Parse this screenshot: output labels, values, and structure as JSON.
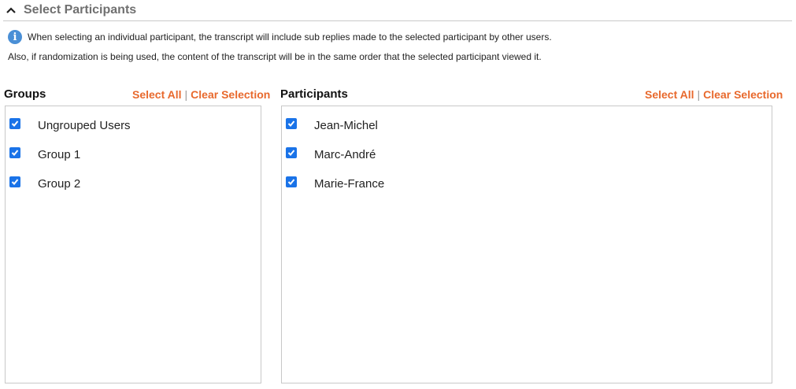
{
  "header": {
    "title": "Select Participants"
  },
  "info": {
    "line1": "When selecting an individual participant, the transcript will include sub replies made to the selected participant by other users.",
    "line2": "Also, if randomization is being used, the content of the transcript will be in the same order that the selected participant viewed it."
  },
  "groups": {
    "label": "Groups",
    "select_all": "Select All",
    "separator": "|",
    "clear_selection": "Clear Selection",
    "items": [
      {
        "label": "Ungrouped Users",
        "checked": true
      },
      {
        "label": "Group 1",
        "checked": true
      },
      {
        "label": "Group 2",
        "checked": true
      }
    ]
  },
  "participants": {
    "label": "Participants",
    "select_all": "Select All",
    "separator": "|",
    "clear_selection": "Clear Selection",
    "items": [
      {
        "label": "Jean-Michel",
        "checked": true
      },
      {
        "label": "Marc-André",
        "checked": true
      },
      {
        "label": "Marie-France",
        "checked": true
      }
    ]
  },
  "colors": {
    "accent": "#e8692d",
    "checkbox": "#1a73e8",
    "info": "#4a8fd6"
  }
}
